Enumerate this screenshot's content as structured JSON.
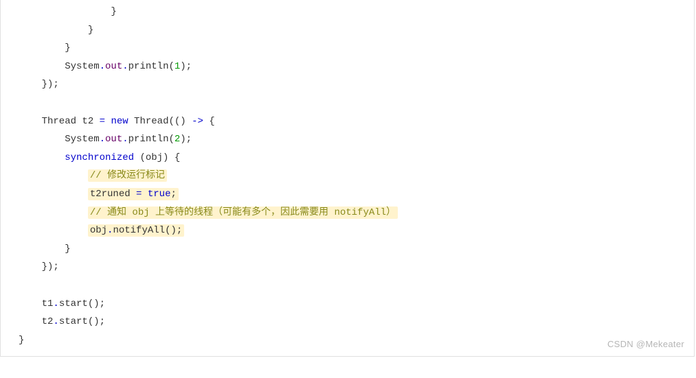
{
  "code": {
    "l1": "                }",
    "l2": "            }",
    "l3": "        }",
    "l4a": "        System",
    "l4b": ".",
    "l4c": "out",
    "l4d": ".",
    "l4e": "println",
    "l4f": "(",
    "l4g": "1",
    "l4h": ");",
    "l5": "    });",
    "l6": "",
    "l7a": "    Thread t2 ",
    "l7b": "=",
    "l7c": " ",
    "l7d": "new",
    "l7e": " Thread(() ",
    "l7f": "->",
    "l7g": " {",
    "l8a": "        System",
    "l8b": ".",
    "l8c": "out",
    "l8d": ".",
    "l8e": "println",
    "l8f": "(",
    "l8g": "2",
    "l8h": ");",
    "l9a": "        ",
    "l9b": "synchronized",
    "l9c": " (obj) {",
    "l10a": "            ",
    "l10b": "// 修改运行标记",
    "l11a": "            ",
    "l11b": "t2runed ",
    "l11c": "=",
    "l11d": " ",
    "l11e": "true",
    "l11f": ";",
    "l12a": "            ",
    "l12b": "// 通知 obj 上等待的线程（可能有多个，因此需要用 notifyAll）",
    "l13a": "            ",
    "l13b": "obj",
    "l13c": ".",
    "l13d": "notifyAll",
    "l13e": "();",
    "l14": "        }",
    "l15": "    });",
    "l16": "",
    "l17a": "    t1",
    "l17b": ".",
    "l17c": "start",
    "l17d": "();",
    "l18a": "    t2",
    "l18b": ".",
    "l18c": "start",
    "l18d": "();",
    "l19": "}"
  },
  "watermark": "CSDN @Mekeater"
}
